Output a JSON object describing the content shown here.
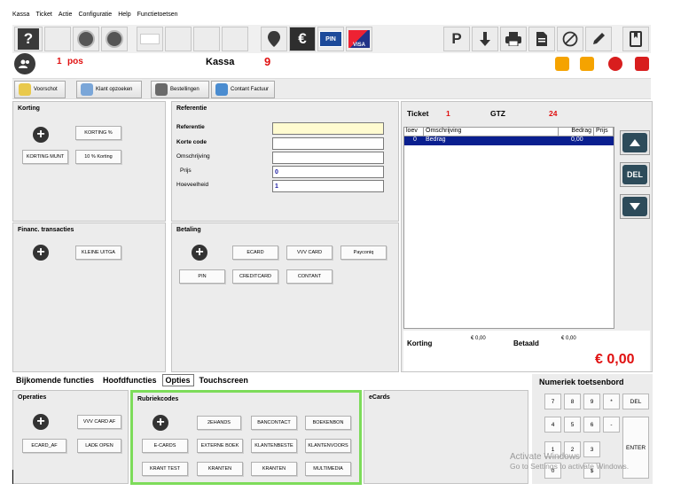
{
  "menu": [
    "Kassa",
    "Ticket",
    "Actie",
    "Configuratie",
    "Help",
    "Functietoetsen"
  ],
  "toolbar": {
    "help_glyph": "?",
    "parking_glyph": "P",
    "euro_glyph": "€",
    "pin_label": "PIN",
    "visa_label": "VISA"
  },
  "status": {
    "pos_count": "1",
    "pos_label": "pos",
    "mode_label": "Kassa",
    "mode_number": "9"
  },
  "actions": [
    "Voorschot",
    "Klant opzoeken",
    "Bestellingen",
    "Contant Factuur"
  ],
  "korting": {
    "title": "Korting",
    "buttons": [
      "KORTING %",
      "KORTING MUNT",
      "10 % Korting"
    ]
  },
  "referentie": {
    "title": "Referentie",
    "fields": [
      {
        "label": "Referentie",
        "value": ""
      },
      {
        "label": "Korte code",
        "value": ""
      },
      {
        "label": "Omschrijving",
        "value": ""
      },
      {
        "label": "Prijs",
        "value": "0"
      },
      {
        "label": "Hoeveelheid",
        "value": "1"
      }
    ]
  },
  "financ": {
    "title": "Financ. transacties",
    "buttons": [
      "KLEINE UITGA"
    ]
  },
  "betaling": {
    "title": "Betaling",
    "buttons": [
      "ECARD",
      "VVV CARD",
      "Payconiq",
      "PIN",
      "CREDITCARD",
      "CONTANT"
    ]
  },
  "ticket": {
    "label": "Ticket",
    "number": "1",
    "gtz_label": "GTZ",
    "gtz_value": "24",
    "columns": [
      "loev",
      "Omschrijving",
      "Bedrag",
      "Prijs"
    ],
    "rows": [
      {
        "qty": "0",
        "desc": "Bedrag",
        "amount": "0,00",
        "price": ""
      }
    ],
    "del_label": "DEL",
    "korting_label": "Korting",
    "korting_value": "€ 0,00",
    "betaald_label": "Betaald",
    "betaald_value": "€ 0,00",
    "total": "€ 0,00"
  },
  "tabs": [
    "Bijkomende functies",
    "Hoofdfuncties",
    "Opties",
    "Touchscreen"
  ],
  "operaties": {
    "title": "Operaties",
    "buttons": [
      "VVV CARD AF",
      "ECARD_AF",
      "LADE OPEN"
    ]
  },
  "rubriek": {
    "title": "Rubriekcodes",
    "buttons": [
      "2EHANDS",
      "BANCONTACT",
      "BOEKENBON",
      "E-CARDS",
      "EXTERNE BOEK",
      "KLANTENBESTE",
      "KLANTENVOORS",
      "KRANT TEST",
      "KRANTEN",
      "KRANTEN",
      "MULTIMEDIA"
    ]
  },
  "ecards": {
    "title": "eCards"
  },
  "numpad": {
    "title": "Numeriek toetsenbord",
    "keys": [
      "7",
      "8",
      "9",
      "*",
      "DEL",
      "4",
      "5",
      "6",
      "-",
      "1",
      "2",
      "3",
      "ENTER",
      "0",
      "$"
    ]
  },
  "watermark": {
    "line1": "Activate Windows",
    "line2": "Go to Settings to activate Windows."
  },
  "colors": {
    "accent_red": "#e01010",
    "selection_blue": "#0a1f8f",
    "highlight_green": "#7ddc5a",
    "field_yellow": "#fffbd0"
  }
}
